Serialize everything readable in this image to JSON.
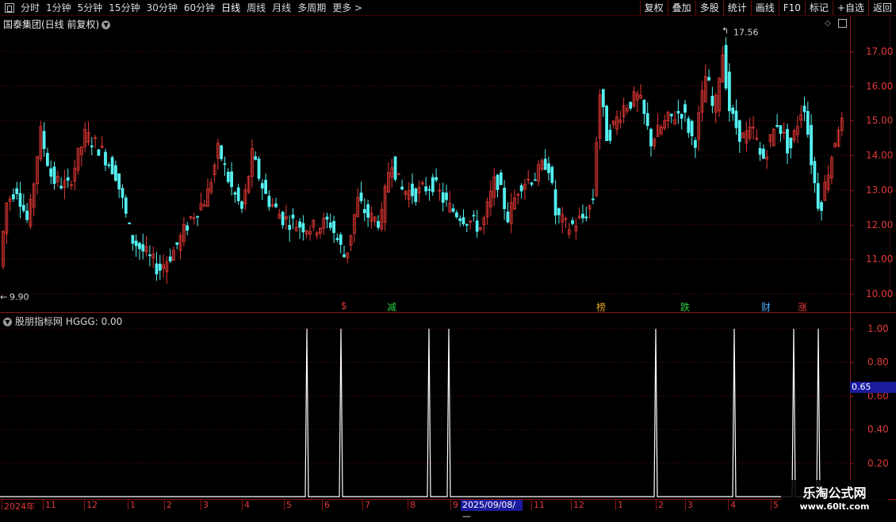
{
  "toolbar": {
    "periods": [
      "分时",
      "1分钟",
      "5分钟",
      "15分钟",
      "30分钟",
      "60分钟",
      "日线",
      "周线",
      "月线",
      "多周期",
      "更多"
    ],
    "active_period": "日线",
    "right_buttons": [
      "复权",
      "叠加",
      "多股",
      "统计",
      "画线",
      "F10",
      "标记",
      "+自选",
      "返回"
    ]
  },
  "chart": {
    "stock_title": "国泰集团(日线 前复权)",
    "high_label": "17.56",
    "low_label": "9.90",
    "price_ticks": [
      "17.00",
      "16.00",
      "15.00",
      "14.00",
      "13.00",
      "12.00",
      "11.00",
      "10.00"
    ],
    "signals": [
      {
        "text": "$",
        "color": "#e03a3a"
      },
      {
        "text": "减",
        "color": "#2ecc40"
      },
      {
        "text": "榜",
        "color": "#e8a020"
      },
      {
        "text": "跌",
        "color": "#2ecc40"
      },
      {
        "text": "财",
        "color": "#4aa8ff"
      },
      {
        "text": "涨",
        "color": "#e03a3a"
      }
    ],
    "up_color": "#e53935",
    "down_color": "#54f0f0"
  },
  "indicator": {
    "title": "股朋指标网  HGGG: 0.00",
    "ticks": [
      "1.00",
      "0.80",
      "0.60",
      "0.40",
      "0.20"
    ],
    "current_value": "0.65",
    "spike_count": 8
  },
  "dates": {
    "labels": [
      "2024年",
      "11",
      "12",
      "1",
      "2",
      "3",
      "4",
      "5",
      "6",
      "7",
      "8",
      "9",
      "11",
      "12",
      "1",
      "2",
      "3",
      "4",
      "5"
    ],
    "crosshair_date": "2025/09/08/—"
  },
  "watermark": {
    "line1": "乐淘公式网",
    "line2": "www.60lt.com"
  }
}
